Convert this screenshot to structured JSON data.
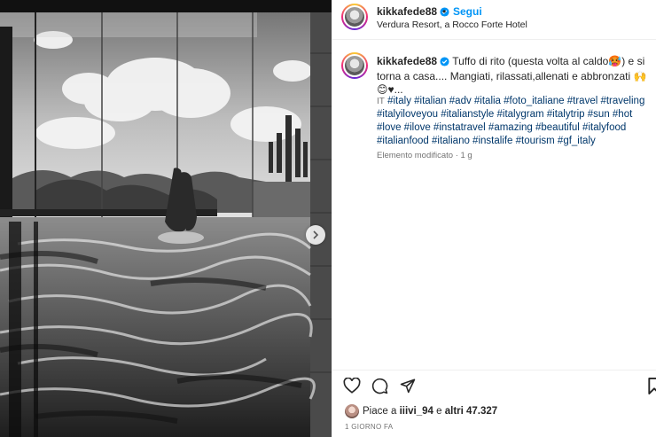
{
  "post": {
    "username": "kikkafede88",
    "follow_label": "Segui",
    "separator": "•",
    "location": "Verdura Resort, a Rocco Forte Hotel"
  },
  "caption": {
    "username": "kikkafede88",
    "text": "Tuffo di rito (questa volta al caldo🥵) e si torna a casa.... Mangiati, rilassati,allenati e abbronzati 🙌😊♥...",
    "lang_label": "IT",
    "hashtags": "#italy #italian #adv #italia #foto_italiane #travel #traveling #italyiloveyou #italianstyle #italygram #italytrip #sun #hot #love #ilove #instatravel #amazing #beautiful #italyfood #italianfood #italiano #instalife #tourism #gf_italy",
    "edited": "Elemento modificato · 1 g"
  },
  "likes": {
    "prefix": "Piace a ",
    "user": "iiivi_94",
    "middle": " e ",
    "others": "altri 47.327"
  },
  "timestamp": "1 GIORNO FA",
  "icons": {
    "like": "heart-icon",
    "comment": "comment-icon",
    "share": "send-icon",
    "save": "bookmark-icon",
    "next": "chevron-right-icon",
    "verified": "verified-badge-icon"
  },
  "colors": {
    "accent": "#0095f6",
    "hashtag": "#00376b",
    "muted": "#737373",
    "verified": "#0095f6"
  }
}
